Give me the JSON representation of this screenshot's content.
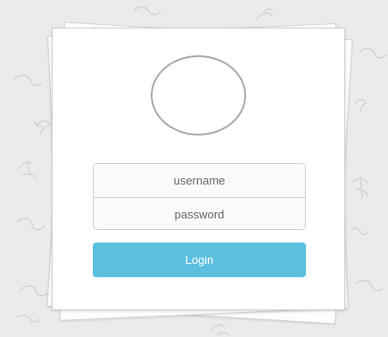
{
  "login_form": {
    "username_placeholder": "username",
    "password_placeholder": "password",
    "login_label": "Login"
  },
  "theme": {
    "background": "#ebebeb",
    "card": "#ffffff",
    "avatar_border": "#a9a9a9",
    "button": "#5bc0de",
    "button_text": "#ffffff"
  },
  "icons": {
    "avatar": "avatar-circle",
    "background_pattern": "leaf-and-squiggle-doodles"
  }
}
